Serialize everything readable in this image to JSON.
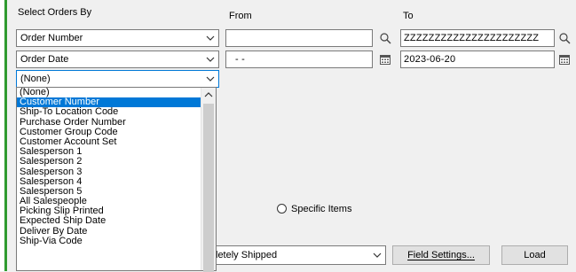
{
  "labels": {
    "select_orders_by": "Select Orders By",
    "from": "From",
    "to": "To"
  },
  "criteria": [
    {
      "field": "Order Number",
      "from": "",
      "to": "ZZZZZZZZZZZZZZZZZZZZZZ",
      "icon": "search-icon"
    },
    {
      "field": "Order Date",
      "from": "- -",
      "to": "2023-06-20",
      "icon": "calendar-icon"
    },
    {
      "field": "(None)"
    }
  ],
  "dropdown": {
    "options": [
      "(None)",
      "Customer Number",
      "Ship-To Location Code",
      "Purchase Order Number",
      "Customer Group Code",
      "Customer Account Set",
      "Salesperson 1",
      "Salesperson 2",
      "Salesperson 3",
      "Salesperson 4",
      "Salesperson 5",
      "All Salespeople",
      "Picking Slip Printed",
      "Expected Ship Date",
      "Deliver By Date",
      "Ship-Via Code"
    ],
    "selected": "Customer Number"
  },
  "specific_items_label": "Specific Items",
  "status_combo": "letely Shipped",
  "buttons": {
    "field_settings": "Field Settings...",
    "load": "Load"
  },
  "colors": {
    "selection": "#0078d7",
    "accent_bar": "#2f9a2f"
  }
}
